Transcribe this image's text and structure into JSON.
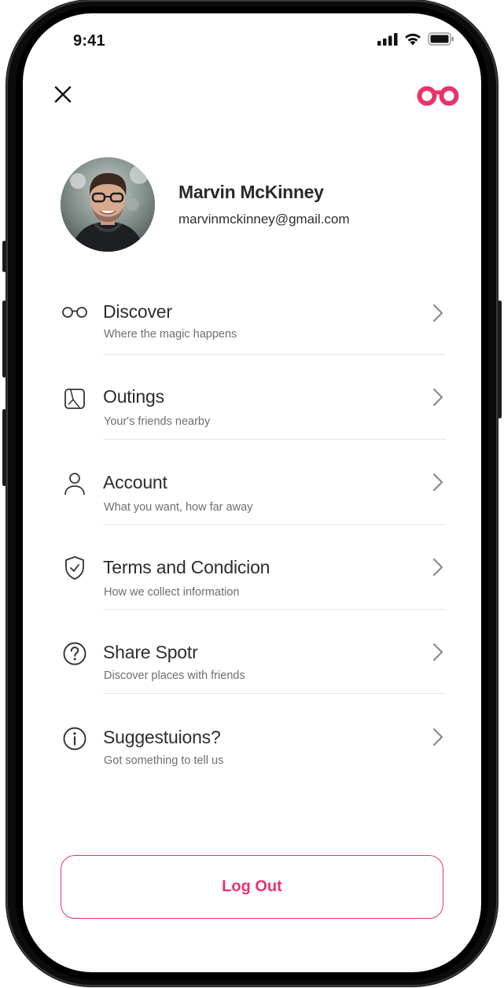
{
  "status_bar": {
    "time": "9:41"
  },
  "header": {
    "close_icon": "close-icon",
    "brand_icon": "spotr-logo-icon",
    "accent_color": "#E8336D"
  },
  "profile": {
    "name": "Marvin McKinney",
    "email": "marvinmckinney@gmail.com"
  },
  "menu": {
    "items": [
      {
        "icon": "binoculars-icon",
        "label": "Discover",
        "subtitle": "Where the magic happens"
      },
      {
        "icon": "map-icon",
        "label": "Outings",
        "subtitle": "Your's friends nearby"
      },
      {
        "icon": "user-icon",
        "label": "Account",
        "subtitle": "What you want, how far away"
      },
      {
        "icon": "shield-check-icon",
        "label": "Terms and Condicion",
        "subtitle": "How we collect information"
      },
      {
        "icon": "question-circle-icon",
        "label": "Share Spotr",
        "subtitle": "Discover places with friends"
      },
      {
        "icon": "info-circle-icon",
        "label": "Suggestuions?",
        "subtitle": "Got something to tell us"
      }
    ]
  },
  "logout": {
    "label": "Log Out"
  }
}
